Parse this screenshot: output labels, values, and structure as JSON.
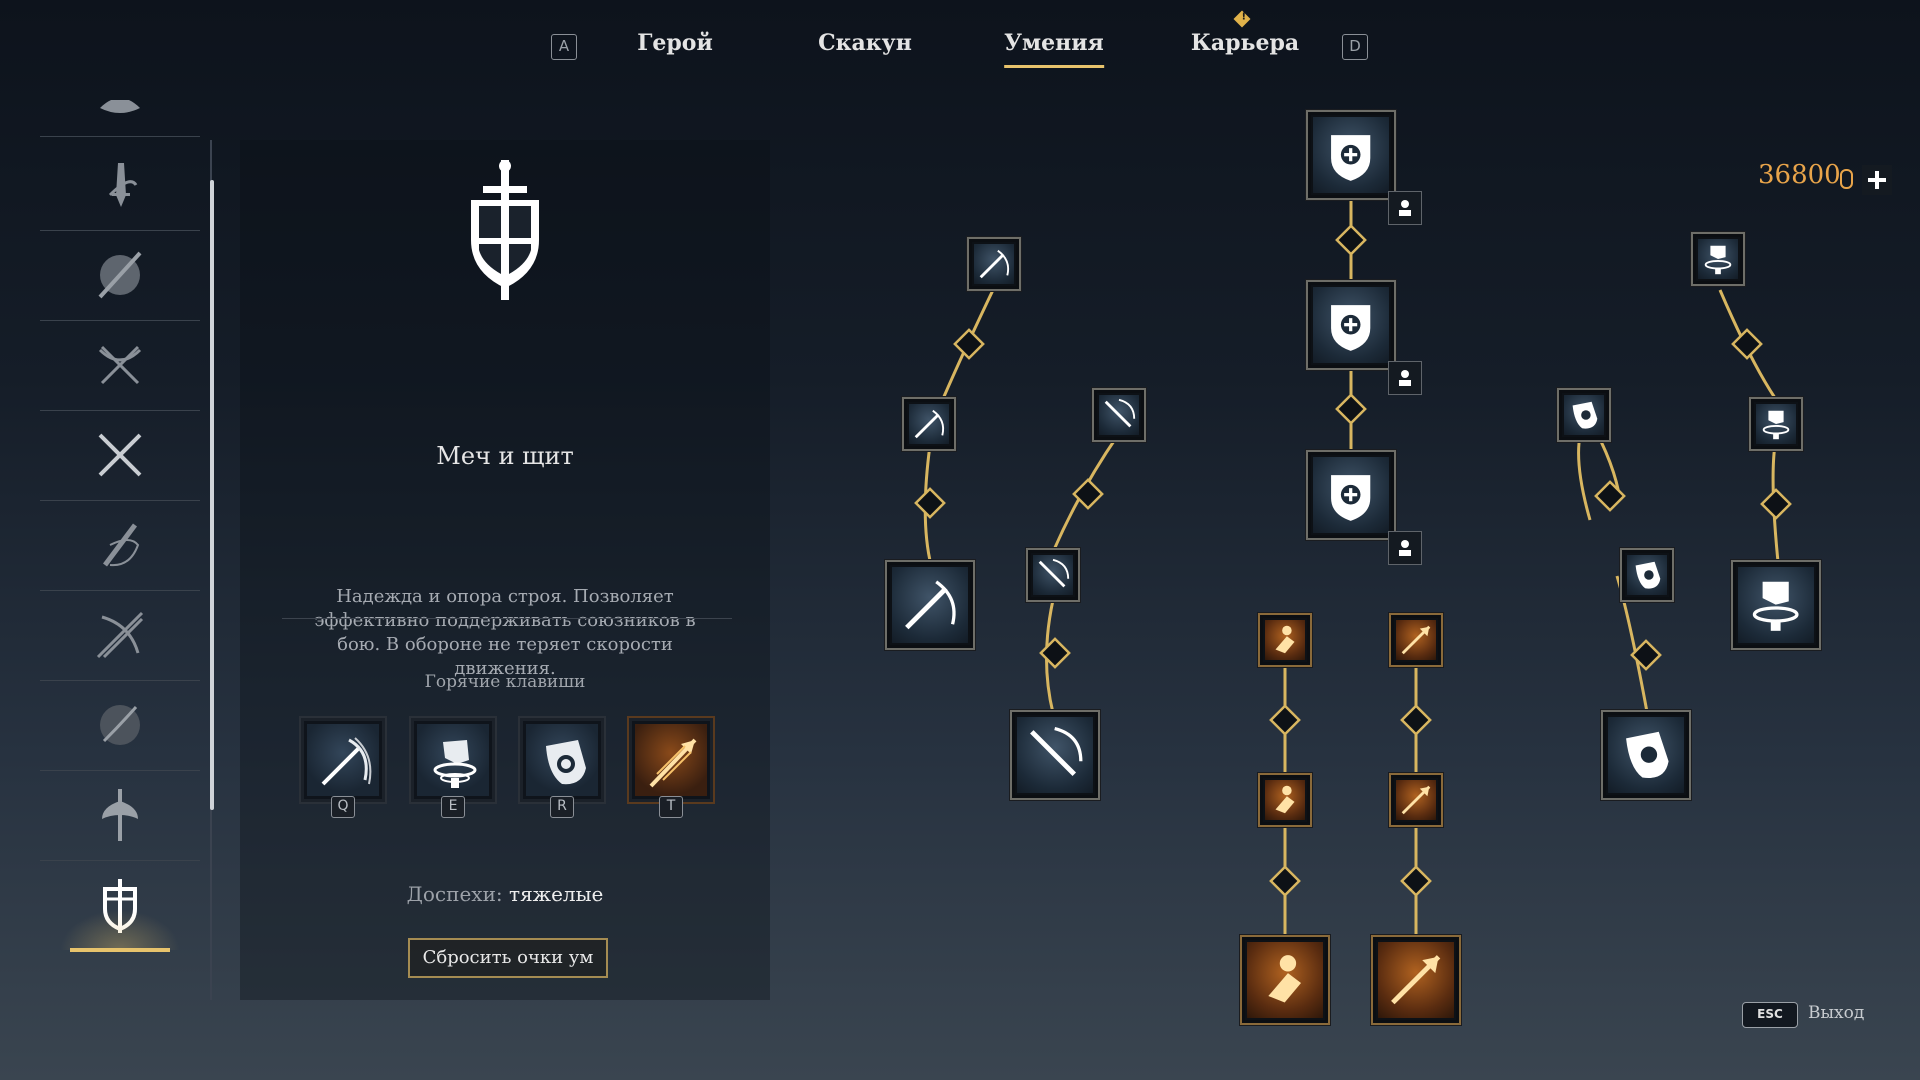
{
  "nav": {
    "left_key": "A",
    "right_key": "D",
    "tabs": [
      {
        "label": "Герой"
      },
      {
        "label": "Скакун"
      },
      {
        "label": "Умения",
        "active": true
      },
      {
        "label": "Карьера",
        "notification": true
      }
    ],
    "notification_glyph": "!"
  },
  "sidebar": {
    "items": [
      {
        "icon": "leaf-icon"
      },
      {
        "icon": "dagger-icon"
      },
      {
        "icon": "spear-shield-icon"
      },
      {
        "icon": "crossbow-icon"
      },
      {
        "icon": "crossed-swords-icon"
      },
      {
        "icon": "musket-icon"
      },
      {
        "icon": "crossed-bows-icon"
      },
      {
        "icon": "saber-shield-icon"
      },
      {
        "icon": "halberd-icon"
      },
      {
        "icon": "sword-and-shield-icon",
        "active": true
      }
    ]
  },
  "class_info": {
    "title": "Меч и щит",
    "description": "Надежда и опора строя. Позволяет эффективно поддерживать союзников в бою. В обороне не теряет скорости движения.",
    "hotkeys_label": "Горячие клавиши",
    "hotkeys": [
      {
        "key": "Q",
        "icon": "sword-slash-icon"
      },
      {
        "key": "E",
        "icon": "whirlwind-icon"
      },
      {
        "key": "R",
        "icon": "shield-bash-icon"
      },
      {
        "key": "T",
        "icon": "piercing-arrow-icon",
        "gold": true
      }
    ],
    "armor_label": "Доспехи:",
    "armor_value": "тяжелые",
    "reset_button": "Сбросить очки ум"
  },
  "currency": {
    "amount": "36800",
    "icon": "coin-icon"
  },
  "footer": {
    "esc_key": "ESC",
    "esc_label": "Выход"
  },
  "colors": {
    "accent": "#e7c36c",
    "gold_node": "#b06220",
    "currency": "#e8a44a"
  }
}
